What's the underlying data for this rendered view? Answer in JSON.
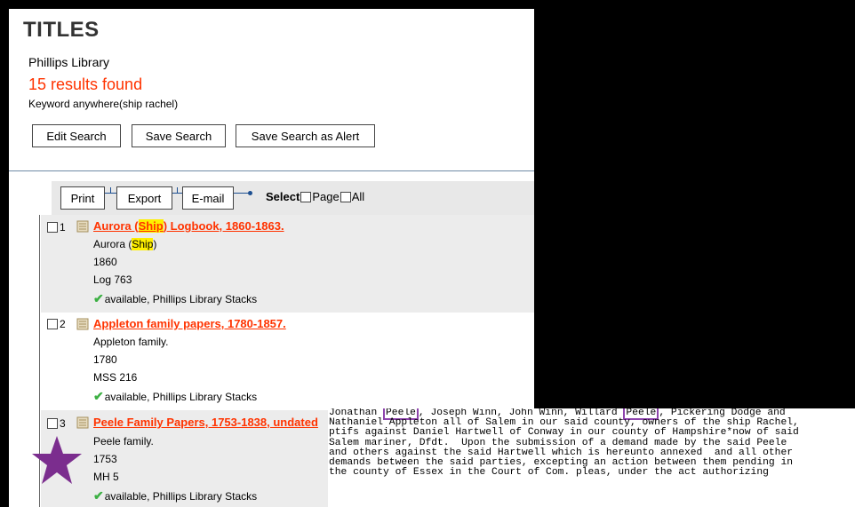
{
  "header": {
    "title": "TITLES",
    "library": "Phillips Library",
    "results": "15 results found",
    "keyword": "Keyword anywhere(ship rachel)"
  },
  "search_buttons": {
    "edit": "Edit Search",
    "save": "Save Search",
    "alert": "Save Search as Alert"
  },
  "toolbar": {
    "print": "Print",
    "export": "Export",
    "email": "E-mail",
    "select": "Select",
    "page": "Page",
    "all": "All"
  },
  "records": [
    {
      "num": "1",
      "title_pre": "Aurora (",
      "title_hl": "Ship",
      "title_post": ") Logbook, 1860-1863.",
      "line1_pre": "Aurora (",
      "line1_hl": "Ship",
      "line1_post": ")",
      "line2": "1860",
      "line3": "Log 763",
      "avail": "available, Phillips Library Stacks"
    },
    {
      "num": "2",
      "title": "Appleton family papers, 1780-1857.",
      "line1": "Appleton family.",
      "line2": "1780",
      "line3": "MSS 216",
      "avail": "available, Phillips Library Stacks"
    },
    {
      "num": "3",
      "title": "Peele Family Papers, 1753-1838, undated",
      "line1": "Peele family.",
      "line2": "1753",
      "line3": "MH 5",
      "avail": "available, Phillips Library Stacks"
    }
  ],
  "document": {
    "line1_a": "Jonathan ",
    "line1_peele1": "Peele",
    "line1_b": ", Joseph Winn, John Winn, Willard ",
    "line1_peele2": "Peele",
    "line1_c": ", Pickering Dodge and",
    "line2": "Nathaniel Appleton all of Salem in our said county, owners of the ship Rachel,",
    "line3": "ptifs against Daniel Hartwell of Conway in our county of Hampshire*now of said",
    "line4": "Salem mariner, Dfdt.  Upon the submission of a demand made by the said Peele",
    "line5": "and others against the said Hartwell which is hereunto annexed  and all other",
    "line6": "demands between the said parties, excepting an action between them pending in",
    "line7": "the county of Essex in the Court of Com. pleas, under the act authorizing"
  },
  "colors": {
    "accent_red": "#ff3300",
    "highlight": "#ffef00",
    "annotation_purple": "#8e44ad",
    "link_line": "#1d4f91",
    "available_green": "#3cb043"
  },
  "icons": [
    "book-icon",
    "checkmark-icon",
    "star-icon"
  ]
}
